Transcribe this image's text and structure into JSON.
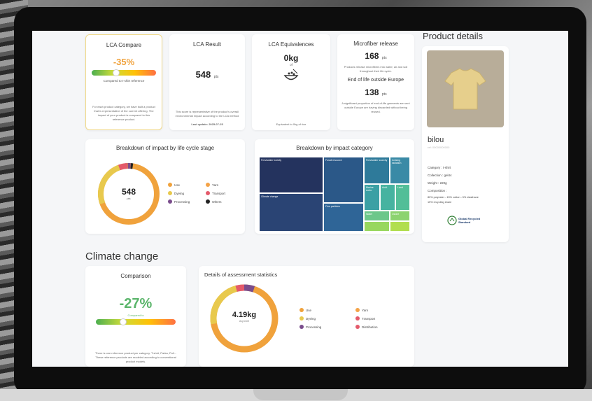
{
  "lca_compare": {
    "title": "LCA Compare",
    "value": "-35%",
    "subtitle": "Compared to t-shirt reference",
    "note": "For each product category, we have built a product that is representative of the current offering. The impact of your product is compared to this reference product."
  },
  "lca_result": {
    "title": "LCA Result",
    "value": "548",
    "unit": "pts",
    "note": "This score is representative of the product's overall environmental impact according to the LCA method",
    "updated": "Last update: 2025-07-25",
    "level": 0.72
  },
  "lca_equivalences": {
    "title": "LCA Equivalences",
    "value": "0kg",
    "of": "of",
    "caption": "Equivalent to 0kg of rice"
  },
  "microfiber": {
    "title": "Microfiber release",
    "value": "168",
    "unit": "pts",
    "note": "Products release microfibers into water, air and soil throughout their life cycle.",
    "eol_title": "End of life outside Europe",
    "eol_value": "138",
    "eol_unit": "pts",
    "eol_note": "A significant proportion of end-of-life garments are sent outside Europe are having discarded without being reused."
  },
  "product": {
    "heading": "Product details",
    "name": "bilou",
    "ref": "ref: 00000000000",
    "category": "Category : t-shirt",
    "collection": "Collection : gel44",
    "weight": "Weight : 220g",
    "composition_label": "Composition :",
    "composition": "80% polyester - 15% cotton - 5% elasthane",
    "recycled": "15% recycling share",
    "badge": "Global Recycled Standard"
  },
  "breakdown_stage": {
    "title": "Breakdown of impact by life cycle stage",
    "value": "548",
    "unit": "pts",
    "legend": [
      {
        "label": "Use",
        "color": "#f0a23c"
      },
      {
        "label": "Yarn",
        "color": "#f4a347"
      },
      {
        "label": "Dyeing",
        "color": "#e8c94d"
      },
      {
        "label": "Transport",
        "color": "#e45a6b"
      },
      {
        "label": "Processing",
        "color": "#7a4c8c"
      },
      {
        "label": "Others",
        "color": "#222222"
      }
    ]
  },
  "breakdown_category": {
    "title": "Breakdown by impact category",
    "cells": [
      "Freshwater toxicity",
      "Fossil resource",
      "Freshwater scarcity",
      "Ionising radiation",
      "Climate change",
      "Marine eutro.",
      "Acid.",
      "Land",
      "Fine particles",
      "Water",
      "Ozone"
    ]
  },
  "climate": {
    "heading": "Climate change",
    "comparison_title": "Comparison",
    "comparison_value": "-27%",
    "comparison_sub": "Compared to",
    "comparison_note": "There is one reference product per category. T-shirt, Parka, Pull... These reference products are modeled according to conventional product models.",
    "details_title": "Details of assessment statistics",
    "value": "4.19kg",
    "unit": "eq CO2",
    "legend": [
      {
        "label": "Use",
        "color": "#f0a23c"
      },
      {
        "label": "Yarn",
        "color": "#f4a347"
      },
      {
        "label": "Dyeing",
        "color": "#e8c94d"
      },
      {
        "label": "Transport",
        "color": "#e45a6b"
      },
      {
        "label": "Processing",
        "color": "#7a4c8c"
      },
      {
        "label": "Distribution",
        "color": "#e45a6b"
      }
    ]
  }
}
